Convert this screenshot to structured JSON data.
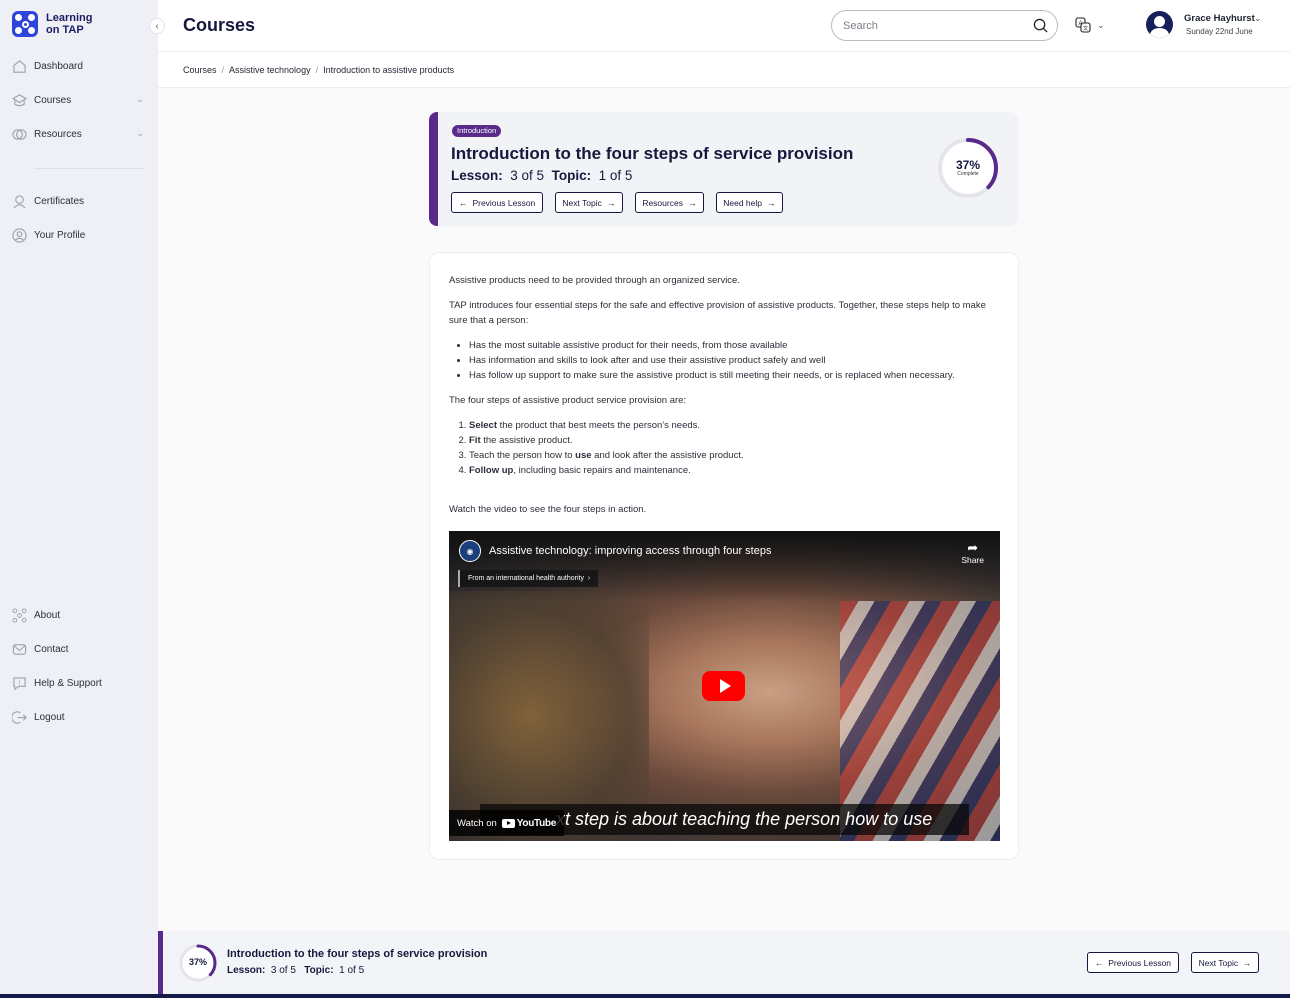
{
  "app": {
    "logo_line1": "Learning",
    "logo_line2": "on TAP",
    "brand_color": "#2f44d8",
    "accent_color": "#5a2a8a"
  },
  "sidebar": {
    "collapse_icon": "chevron-left-icon",
    "items": [
      {
        "label": "Dashboard",
        "icon": "dashboard-icon"
      },
      {
        "label": "Courses",
        "icon": "courses-icon",
        "has_chevron": true
      },
      {
        "label": "Resources",
        "icon": "resources-icon",
        "has_chevron": true
      },
      {
        "label": "Certificates",
        "icon": "certificate-icon"
      },
      {
        "label": "Your Profile",
        "icon": "profile-icon"
      },
      {
        "label": "About",
        "icon": "about-icon"
      },
      {
        "label": "Contact",
        "icon": "contact-icon"
      },
      {
        "label": "Help & Support",
        "icon": "help-icon"
      },
      {
        "label": "Logout",
        "icon": "logout-icon"
      }
    ]
  },
  "header": {
    "title": "Courses",
    "search_placeholder": "Search",
    "user_name": "Grace Hayhurst",
    "user_date": "Sunday 22nd June"
  },
  "breadcrumb": [
    "Courses",
    "Assistive technology",
    "Introduction to assistive products"
  ],
  "lesson": {
    "badge": "Introduction",
    "title": "Introduction to the four steps of service provision",
    "lesson_label": "Lesson:",
    "lesson_value": "3 of 5",
    "topic_label": "Topic:",
    "topic_value": "1 of 5",
    "progress_percent": 37,
    "progress_label": "37%",
    "progress_sub": "Complete",
    "buttons": {
      "previous": "Previous Lesson",
      "next": "Next Topic",
      "resources": "Resources",
      "help": "Need help"
    }
  },
  "content": {
    "p1": "Assistive products need to be provided through an organized service.",
    "p2": "TAP introduces four essential steps for the safe and effective provision of assistive products. Together, these steps help to make sure that a person:",
    "bullets": [
      "Has the most suitable assistive product for their needs, from those available",
      "Has information and skills to look after and use their assistive product safely and well",
      "Has follow up support to make sure the assistive product is still meeting their needs, or is replaced when necessary."
    ],
    "p3": "The four steps of assistive product service provision are:",
    "steps": [
      {
        "pre": "",
        "bold": "Select",
        "post": " the product that best meets the person's needs."
      },
      {
        "pre": "",
        "bold": "Fit",
        "post": " the assistive product."
      },
      {
        "pre": "Teach the person how to ",
        "bold": "use",
        "post": " and look after the assistive product."
      },
      {
        "pre": "",
        "bold": "Follow up",
        "post": ", including basic repairs and maintenance."
      }
    ],
    "p4": "Watch the video to see the four steps in action."
  },
  "video": {
    "title": "Assistive technology: improving access through four steps",
    "share_label": "Share",
    "authority_label": "From an international health authority",
    "caption": "xt step is about teaching the person how to use",
    "watch_on": "Watch on",
    "youtube": "YouTube"
  },
  "footer": {
    "title": "Introduction to the four steps of service provision",
    "lesson_label": "Lesson:",
    "lesson_value": "3 of 5",
    "topic_label": "Topic:",
    "topic_value": "1 of 5",
    "progress_label": "37%",
    "prev_label": "Previous Lesson",
    "next_label": "Next Topic"
  }
}
